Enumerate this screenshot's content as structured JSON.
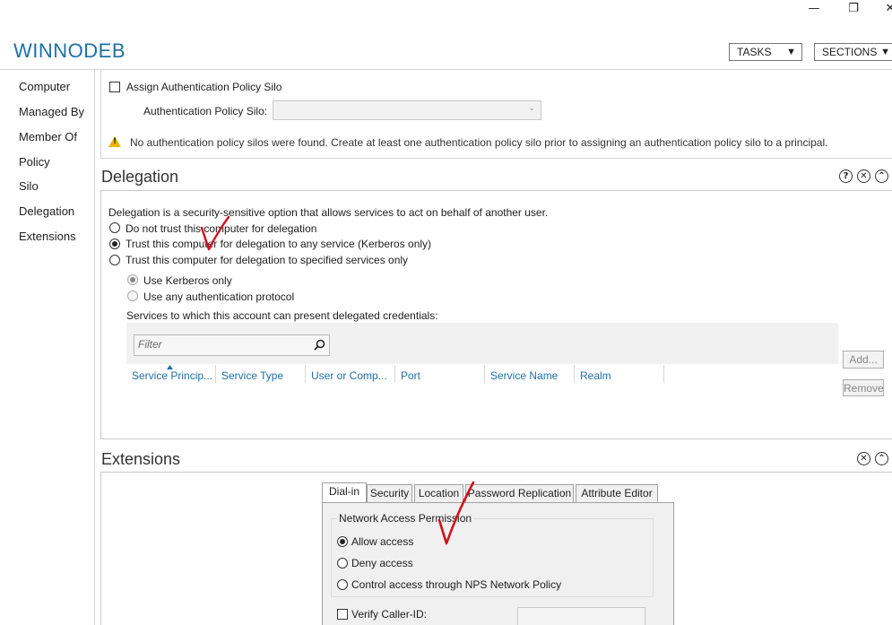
{
  "window": {
    "minimize_glyph": "—",
    "restore_glyph": "❐",
    "close_glyph": "✕"
  },
  "header": {
    "title": "WINNODEB",
    "tasks_label": "TASKS",
    "sections_label": "SECTIONS",
    "dropdown_glyph": "▼"
  },
  "nav": {
    "items": [
      "Computer",
      "Managed By",
      "Member Of",
      "Policy",
      "Silo",
      "Delegation",
      "Extensions"
    ]
  },
  "silo": {
    "assign_label": "Assign Authentication Policy Silo",
    "policy_silo_label": "Authentication Policy Silo:",
    "warning_text": "No authentication policy silos were found. Create at least one authentication policy silo prior to assigning an authentication policy silo to a principal.",
    "warning_icon": "warning-triangle-icon"
  },
  "delegation": {
    "title": "Delegation",
    "help_glyph": "?",
    "close_glyph": "✕",
    "collapse_glyph": "⌃",
    "description": "Delegation is a security-sensitive option that allows services to act on behalf of another user.",
    "options": [
      "Do not trust this computer for delegation",
      "Trust this computer for delegation to any service (Kerberos only)",
      "Trust this computer for delegation to specified services only"
    ],
    "selected_option": 1,
    "sub_options": [
      "Use Kerberos only",
      "Use any authentication protocol"
    ],
    "services_label": "Services to which this account can present delegated credentials:",
    "filter_placeholder": "Filter",
    "columns": [
      "Service Princip...",
      "Service Type",
      "User or Comp...",
      "Port",
      "Service Name",
      "Realm"
    ],
    "add_label": "Add...",
    "remove_label": "Remove"
  },
  "extensions": {
    "title": "Extensions",
    "close_glyph": "✕",
    "collapse_glyph": "⌃",
    "tabs": [
      "Dial-in",
      "Security",
      "Location",
      "Password Replication",
      "Attribute Editor"
    ],
    "active_tab": 0,
    "group_label": "Network Access Permission",
    "nap_options": [
      "Allow access",
      "Deny access",
      "Control access through NPS Network Policy"
    ],
    "nap_selected": 0,
    "verify_caller_label": "Verify Caller-ID:"
  },
  "colors": {
    "accent": "#1f6fa5",
    "annotation": "#d0101c"
  }
}
